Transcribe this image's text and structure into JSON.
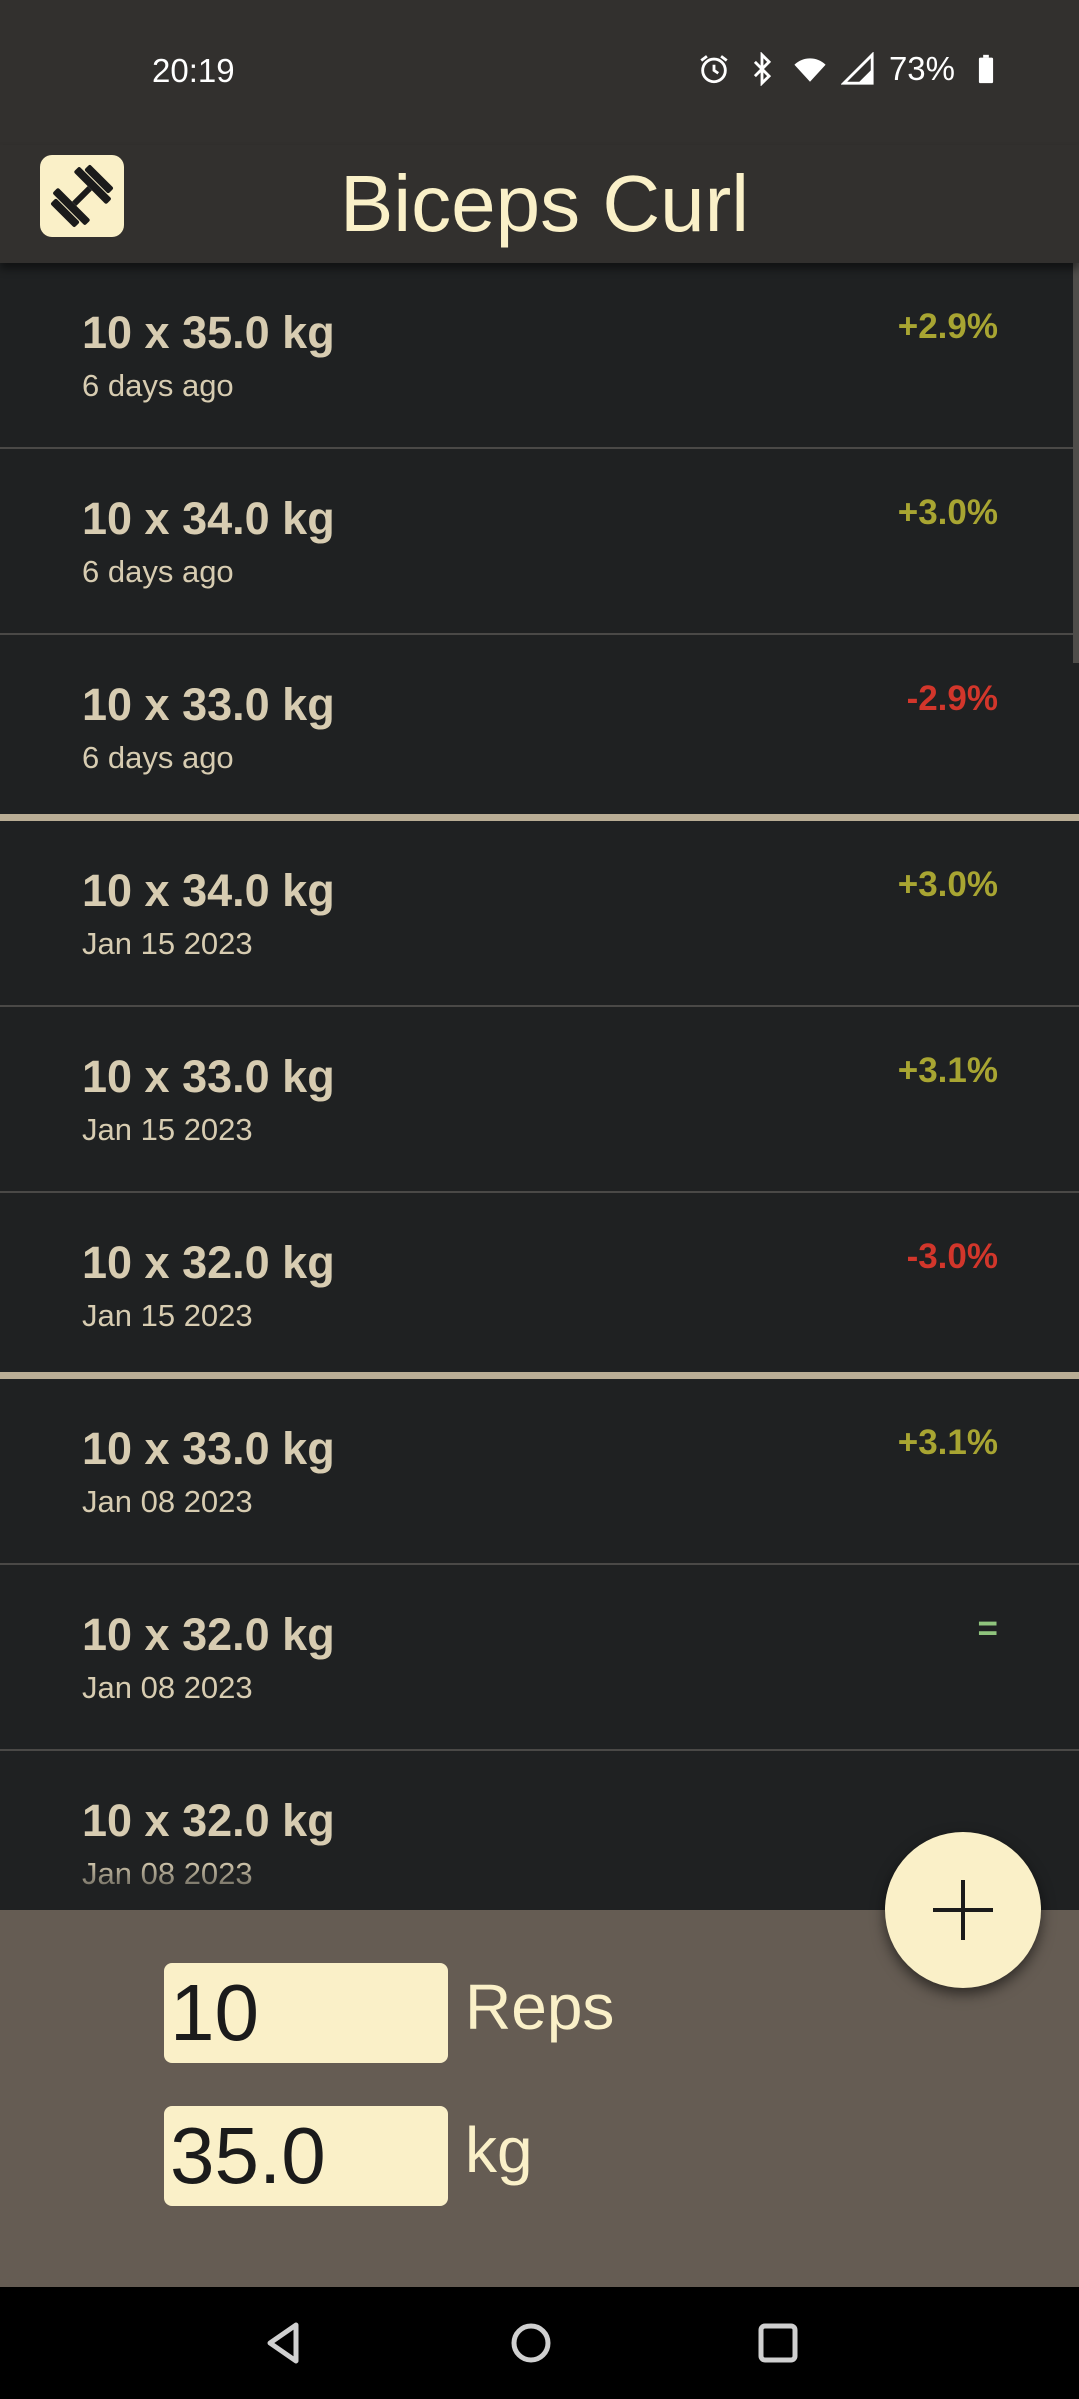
{
  "status": {
    "time": "20:19",
    "battery": "73%"
  },
  "appbar": {
    "title": "Biceps Curl",
    "icon": "dumbbell-icon"
  },
  "entries": [
    {
      "set": "10 x 35.0 kg",
      "when": "6 days ago",
      "delta": "+2.9%",
      "trend": "up"
    },
    {
      "set": "10 x 34.0 kg",
      "when": "6 days ago",
      "delta": "+3.0%",
      "trend": "up"
    },
    {
      "set": "10 x 33.0 kg",
      "when": "6 days ago",
      "delta": "-2.9%",
      "trend": "down"
    },
    {
      "set": "10 x 34.0 kg",
      "when": "Jan 15 2023",
      "delta": "+3.0%",
      "trend": "up"
    },
    {
      "set": "10 x 33.0 kg",
      "when": "Jan 15 2023",
      "delta": "+3.1%",
      "trend": "up"
    },
    {
      "set": "10 x 32.0 kg",
      "when": "Jan 15 2023",
      "delta": "-3.0%",
      "trend": "down"
    },
    {
      "set": "10 x 33.0 kg",
      "when": "Jan 08 2023",
      "delta": "+3.1%",
      "trend": "up"
    },
    {
      "set": "10 x 32.0 kg",
      "when": "Jan 08 2023",
      "delta": "=",
      "trend": "same"
    },
    {
      "set": "10 x 32.0 kg",
      "when": "Jan 08 2023",
      "delta": "",
      "trend": "none"
    }
  ],
  "group_ends": [
    2,
    5
  ],
  "form": {
    "reps_value": "10",
    "reps_unit": "Reps",
    "weight_value": "35.0",
    "weight_unit": "kg"
  },
  "colors": {
    "up": "#a8a532",
    "down": "#d2362b",
    "same": "#8fc47d",
    "accent": "#faf0c8"
  },
  "icons": [
    "alarm-icon",
    "bluetooth-icon",
    "wifi-icon",
    "signal-icon",
    "battery-icon",
    "add-icon",
    "back-icon",
    "home-icon",
    "recents-icon"
  ]
}
